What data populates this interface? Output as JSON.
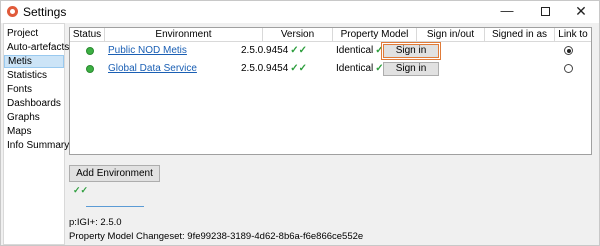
{
  "window": {
    "title": "Settings",
    "controls": {
      "minimize": "—",
      "close": "✕"
    }
  },
  "sidebar": {
    "items": [
      {
        "label": "Project",
        "selected": false
      },
      {
        "label": "Auto-artefacts",
        "selected": false
      },
      {
        "label": "Metis",
        "selected": true
      },
      {
        "label": "Statistics",
        "selected": false
      },
      {
        "label": "Fonts",
        "selected": false
      },
      {
        "label": "Dashboards",
        "selected": false
      },
      {
        "label": "Graphs",
        "selected": false
      },
      {
        "label": "Maps",
        "selected": false
      },
      {
        "label": "Info Summary",
        "selected": false
      }
    ]
  },
  "table": {
    "columns": [
      "Status",
      "Environment",
      "Version",
      "Property Model",
      "Sign in/out",
      "Signed in as",
      "Link to"
    ],
    "rows": [
      {
        "status": "green",
        "environment": "Public NOD Metis",
        "version": "2.5.0.9454",
        "version_check": "✓✓",
        "property_model": "Identical",
        "property_check": "✓✓",
        "sign_label": "Sign in",
        "signed_in_as": "",
        "linked": true
      },
      {
        "status": "green",
        "environment": "Global Data Service",
        "version": "2.5.0.9454",
        "version_check": "✓✓",
        "property_model": "Identical",
        "property_check": "✓✓",
        "sign_label": "Sign in",
        "signed_in_as": "",
        "linked": false
      }
    ]
  },
  "add_environment_label": "Add Environment",
  "status_check": "✓✓",
  "footer": {
    "version_line": "p:IGI+: 2.5.0",
    "changeset_line": "Property Model Changeset: 9fe99238-3189-4d62-8b6a-f6e866ce552e"
  },
  "colors": {
    "status_green": "#3cb043",
    "link_blue": "#1a5fb4",
    "check_green": "#2e9e3e",
    "focus_orange": "#e07b39",
    "selection_blue": "#cce4f7"
  }
}
